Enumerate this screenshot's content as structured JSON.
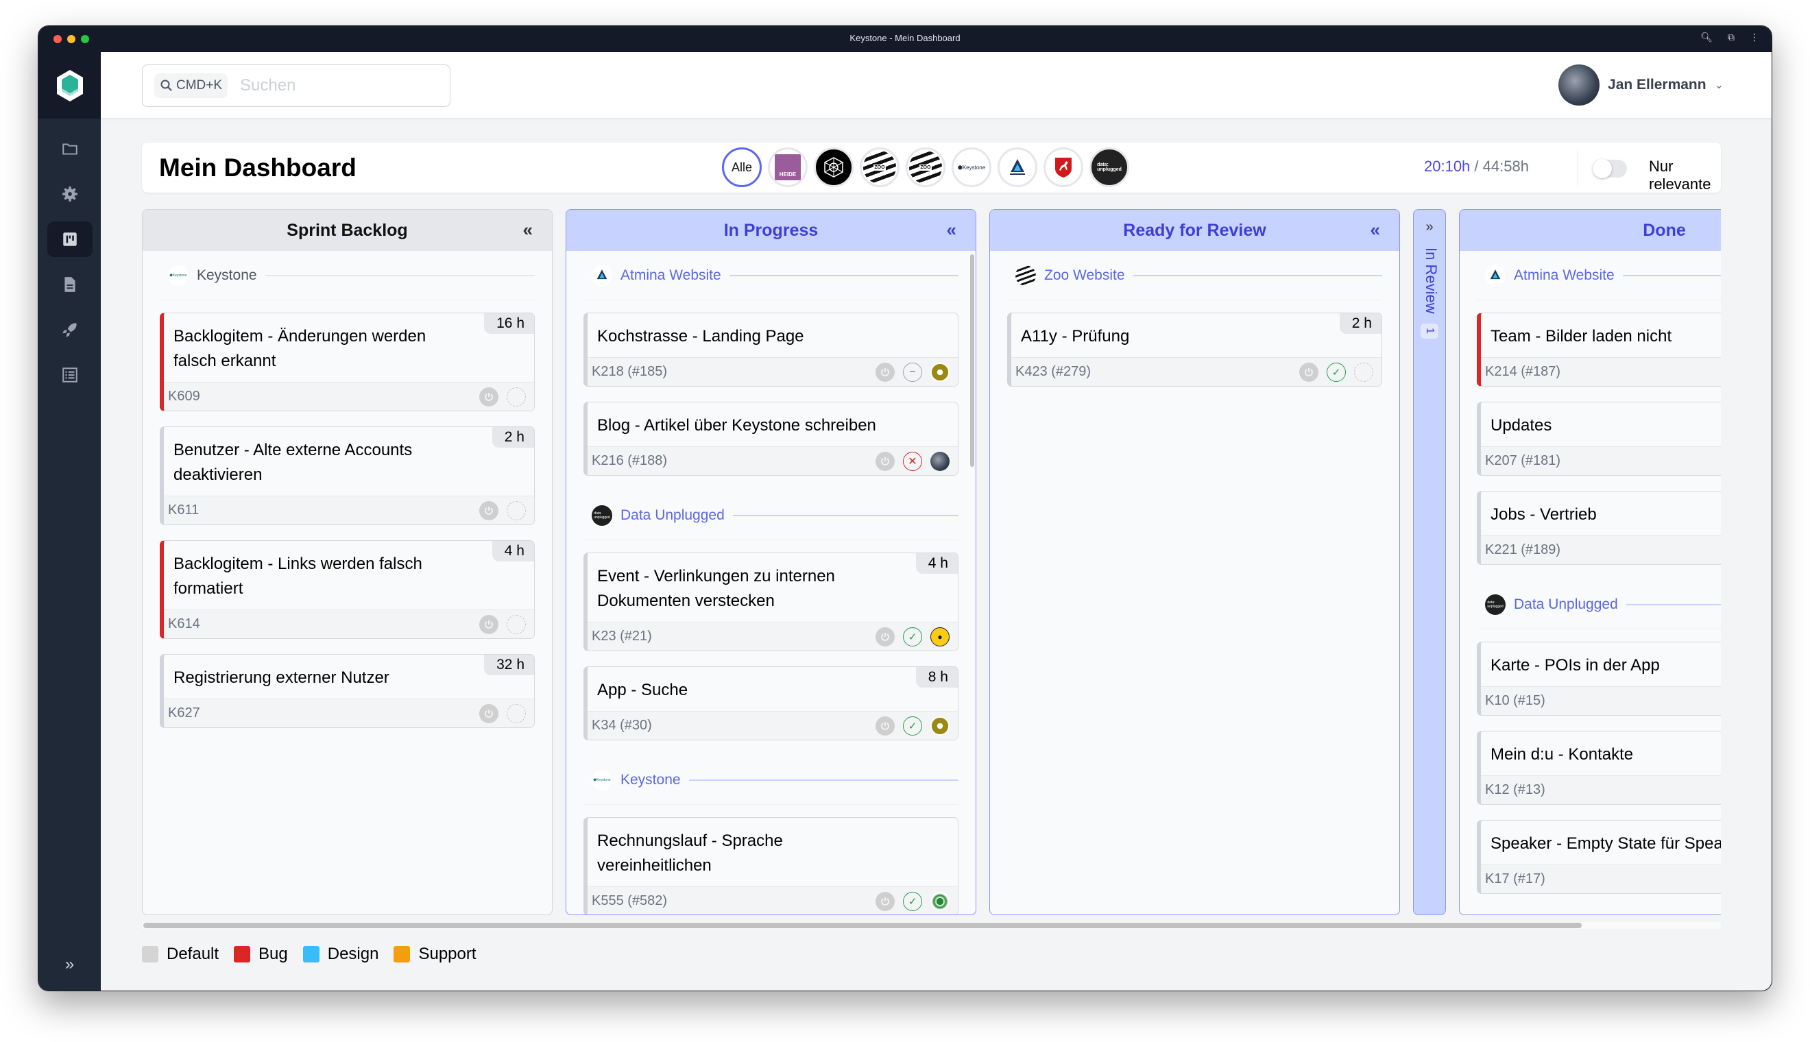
{
  "window": {
    "title": "Keystone - Mein Dashboard"
  },
  "sidebar": {
    "items": [
      {
        "name": "projects",
        "icon": "folder-icon",
        "active": false
      },
      {
        "name": "settings",
        "icon": "gear-icon",
        "active": false
      },
      {
        "name": "board",
        "icon": "kanban-icon",
        "active": true
      },
      {
        "name": "documents",
        "icon": "document-icon",
        "active": false
      },
      {
        "name": "releases",
        "icon": "rocket-icon",
        "active": false
      },
      {
        "name": "list",
        "icon": "list-icon",
        "active": false
      }
    ],
    "expand_icon": "»"
  },
  "header": {
    "search_shortcut": "CMD+K",
    "search_placeholder": "Suchen",
    "search_value": "",
    "user_name": "Jan Ellermann"
  },
  "dashboard": {
    "title": "Mein Dashboard",
    "project_filters": [
      {
        "label": "Alle",
        "active": true
      },
      {
        "label": "Lüneburger Heide",
        "active": false
      },
      {
        "label": "Network",
        "active": false
      },
      {
        "label": "Erlebnis Zoo",
        "active": false
      },
      {
        "label": "Erlebnis Zoo",
        "active": false
      },
      {
        "label": "Keystone",
        "active": false
      },
      {
        "label": "Atmina Solutions",
        "active": false
      },
      {
        "label": "Niedersachsen",
        "active": false
      },
      {
        "label": "data:unplugged",
        "active": false
      }
    ],
    "time_spent": "20:10h",
    "time_separator": " / ",
    "time_total": "44:58h",
    "toggle_label": "Nur relevante",
    "toggle_on": false
  },
  "columns": [
    {
      "title": "Sprint Backlog",
      "collapse_icon": "«",
      "groups": [
        {
          "name": "Keystone",
          "cards": [
            {
              "title": "Backlogitem - Änderungen werden falsch erkannt",
              "id": "K609",
              "hours": "16 h",
              "type": "bug",
              "status": "none",
              "assignee": "none"
            },
            {
              "title": "Benutzer - Alte externe Accounts deaktivieren",
              "id": "K611",
              "hours": "2 h",
              "type": "default",
              "status": "none",
              "assignee": "none"
            },
            {
              "title": "Backlogitem - Links werden falsch formatiert",
              "id": "K614",
              "hours": "4 h",
              "type": "bug",
              "status": "none",
              "assignee": "none"
            },
            {
              "title": "Registrierung externer Nutzer",
              "id": "K627",
              "hours": "32 h",
              "type": "default",
              "status": "none",
              "assignee": "none"
            }
          ]
        }
      ]
    },
    {
      "title": "In Progress",
      "collapse_icon": "«",
      "groups": [
        {
          "name": "Atmina Website",
          "cards": [
            {
              "title": "Kochstrasse - Landing Page",
              "id": "K218 (#185)",
              "hours": "",
              "type": "default",
              "status": "neutral",
              "assignee": "olive"
            },
            {
              "title": "Blog - Artikel über Keystone schreiben",
              "id": "K216 (#188)",
              "hours": "",
              "type": "default",
              "status": "rejected",
              "assignee": "cat"
            }
          ]
        },
        {
          "name": "Data Unplugged",
          "cards": [
            {
              "title": "Event - Verlinkungen zu internen Dokumenten verstecken",
              "id": "K23 (#21)",
              "hours": "4 h",
              "type": "default",
              "status": "approved",
              "assignee": "emoji"
            },
            {
              "title": "App - Suche",
              "id": "K34 (#30)",
              "hours": "8 h",
              "type": "default",
              "status": "approved",
              "assignee": "olive"
            }
          ]
        },
        {
          "name": "Keystone",
          "cards": [
            {
              "title": "Rechnungslauf - Sprache vereinheitlichen",
              "id": "K555 (#582)",
              "hours": "",
              "type": "default",
              "status": "approved",
              "assignee": "green"
            }
          ]
        }
      ]
    },
    {
      "title": "Ready for Review",
      "collapse_icon": "«",
      "groups": [
        {
          "name": "Zoo Website",
          "cards": [
            {
              "title": "A11y - Prüfung",
              "id": "K423 (#279)",
              "hours": "2 h",
              "type": "default",
              "status": "approved",
              "assignee": "none"
            }
          ]
        }
      ]
    },
    {
      "title": "Done",
      "collapse_icon": "«",
      "groups": [
        {
          "name": "Atmina Website",
          "cards": [
            {
              "title": "Team - Bilder laden nicht",
              "id": "K214 (#187)",
              "hours": "",
              "type": "bug"
            },
            {
              "title": "Updates",
              "id": "K207 (#181)",
              "hours": "",
              "type": "default"
            },
            {
              "title": "Jobs - Vertrieb",
              "id": "K221 (#189)",
              "hours": "",
              "type": "default"
            }
          ]
        },
        {
          "name": "Data Unplugged",
          "cards": [
            {
              "title": "Karte - POIs in der App",
              "id": "K10 (#15)",
              "hours": "",
              "type": "default"
            },
            {
              "title": "Mein d:u - Kontakte",
              "id": "K12 (#13)",
              "hours": "",
              "type": "default"
            },
            {
              "title": "Speaker - Empty State für Speaker",
              "id": "K17 (#17)",
              "hours": "",
              "type": "default"
            }
          ]
        }
      ]
    }
  ],
  "collapsed_column": {
    "title": "In Review",
    "count": "1",
    "expand_icon": "»"
  },
  "legend": [
    {
      "label": "Default",
      "color": "#d4d4d4"
    },
    {
      "label": "Bug",
      "color": "#dc2626"
    },
    {
      "label": "Design",
      "color": "#38bdf8"
    },
    {
      "label": "Support",
      "color": "#f59e0b"
    }
  ]
}
